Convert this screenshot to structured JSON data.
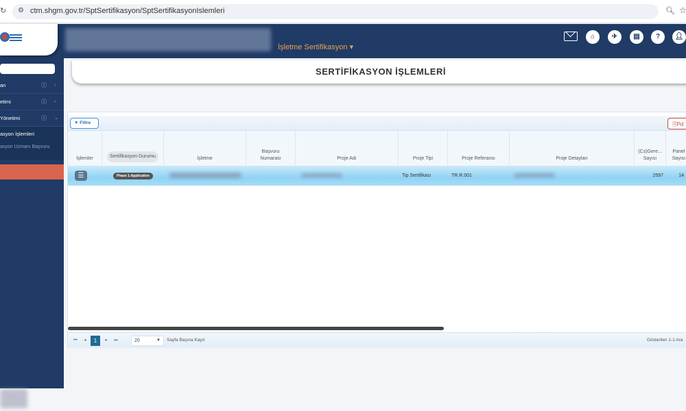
{
  "browser": {
    "url": "ctm.shgm.gov.tr/SptSertifikasyon/SptSertifikasyonIslemleri"
  },
  "header": {
    "module_menu": "İşletme Sertifikasyon ▾",
    "icons": [
      "mail-icon",
      "home-icon",
      "plane-icon",
      "book-icon",
      "help-icon",
      "user-icon"
    ],
    "help_glyph": "?"
  },
  "sidebar": {
    "items": [
      {
        "label": "an"
      },
      {
        "label": "etimi"
      },
      {
        "label": "Yönetimi"
      }
    ],
    "subitems": [
      {
        "label": "asyon İşlemleri"
      },
      {
        "label": "asyon Uzmanı Başvuru"
      }
    ],
    "info_glyph": "ⓘ"
  },
  "page": {
    "title": "SERTİFİKASYON İŞLEMLERİ"
  },
  "toolbar": {
    "filter_label": "Filtre",
    "pdf_label": "Pd"
  },
  "table": {
    "columns": [
      "İşlemler",
      "Sertifikasyon Durumu",
      "İşletme",
      "Başvuru Numarası",
      "Proje Adı",
      "Proje Tipi",
      "Proje Referansı",
      "Proje Detayları",
      "(Cs)Gere... Sayısı",
      "Panel Sayısı"
    ],
    "rows": [
      {
        "status": "Phase 1-Application",
        "proje_tipi": "Tip Sertifikası",
        "proje_referansi": "TR.R.001",
        "cs_sayisi": "2597",
        "panel_sayisi": "14"
      }
    ]
  },
  "pager": {
    "current_page": "1",
    "page_size": "20",
    "page_size_label": "Sayfa Başına Kayıt",
    "summary": "Gösterilen 1-1 Ara"
  },
  "colors": {
    "navy": "#1f3b66",
    "accent_orange": "#e9a050",
    "active_item": "#d9654f"
  }
}
